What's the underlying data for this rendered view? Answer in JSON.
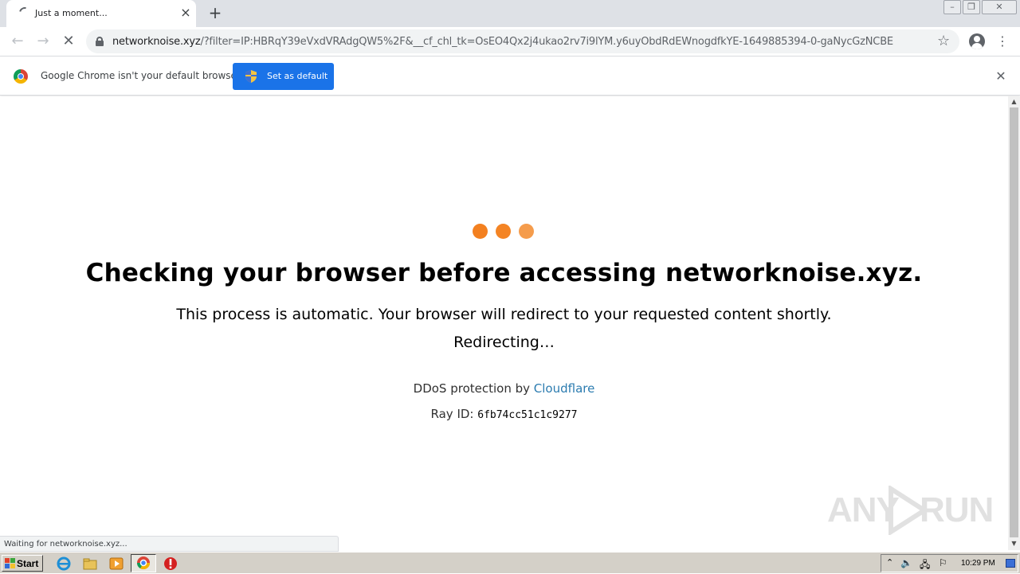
{
  "browser": {
    "tab": {
      "title": "Just a moment...",
      "close_icon": "×"
    },
    "new_tab_icon": "+",
    "window_controls": {
      "minimize": "–",
      "restore": "❐",
      "close": "✕"
    },
    "nav": {
      "back_icon": "←",
      "forward_icon": "→",
      "reload_icon": "✕"
    },
    "url": {
      "host": "networknoise.xyz",
      "path": "/?filter=IP:HBRqY39eVxdVRAdgQW5%2F&__cf_chl_tk=OsEO4Qx2j4ukao2rv7i9lYM.y6uyObdRdEWnogdfkYE-1649885394-0-gaNycGzNCBE"
    },
    "bookmark_icon": "☆",
    "menu_icon": "⋮"
  },
  "infobar": {
    "message": "Google Chrome isn't your default browser",
    "button_label": "Set as default",
    "close_icon": "✕"
  },
  "page": {
    "dots_colors": [
      "#f38020",
      "#f48424",
      "#f59c4c"
    ],
    "headline": "Checking your browser before accessing networknoise.xyz.",
    "subtext": "This process is automatic. Your browser will redirect to your requested content shortly.",
    "redirecting": "Redirecting…",
    "ddos_prefix": "DDoS protection by ",
    "ddos_link": "Cloudflare",
    "ray_label": "Ray ID: ",
    "ray_id": "6fb74cc51c1c9277"
  },
  "status_text": "Waiting for networknoise.xyz...",
  "watermark": {
    "left": "ANY",
    "right": "RUN"
  },
  "taskbar": {
    "start_label": "Start",
    "clock": "10:29 PM"
  },
  "colors": {
    "accent_blue": "#1a73e8",
    "cloudflare_link": "#2c7cb0",
    "cloudflare_orange": "#f38020"
  }
}
